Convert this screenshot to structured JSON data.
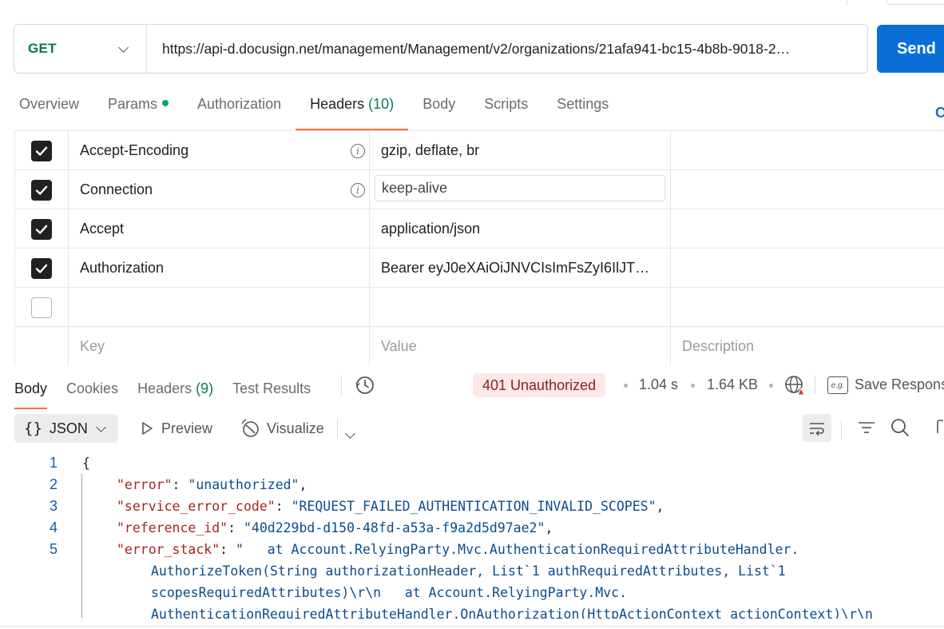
{
  "request": {
    "method": "GET",
    "url": "https://api-d.docusign.net/management/Management/v2/organizations/21afa941-bc15-4b8b-9018-2…",
    "send_label": "Send"
  },
  "request_tabs": [
    {
      "label": "Overview"
    },
    {
      "label": "Params",
      "dot": true
    },
    {
      "label": "Authorization"
    },
    {
      "label": "Headers",
      "count": "(10)",
      "active": true
    },
    {
      "label": "Body"
    },
    {
      "label": "Scripts"
    },
    {
      "label": "Settings"
    }
  ],
  "cookies_fragment": "C",
  "headers_table": {
    "rows": [
      {
        "checked": true,
        "key": "Accept-Encoding",
        "value": "gzip, deflate, br",
        "info": true
      },
      {
        "checked": true,
        "key": "Connection",
        "value": "keep-alive",
        "info": true,
        "editing": true
      },
      {
        "checked": true,
        "key": "Accept",
        "value": "application/json"
      },
      {
        "checked": true,
        "key": "Authorization",
        "value": "Bearer eyJ0eXAiOiJNVCIsImFsZyI6IlJT…"
      },
      {
        "checked": false,
        "key": "",
        "value": ""
      }
    ],
    "placeholders": {
      "key": "Key",
      "value": "Value",
      "description": "Description"
    }
  },
  "response": {
    "tabs": [
      {
        "label": "Body",
        "active": true
      },
      {
        "label": "Cookies"
      },
      {
        "label": "Headers",
        "count": "(9)"
      },
      {
        "label": "Test Results"
      }
    ],
    "status": "401 Unauthorized",
    "time": "1.04 s",
    "size": "1.64 KB",
    "save_label": "Save Respons",
    "save_icon_text": "e.g.",
    "format": "JSON",
    "format_braces": "{}",
    "preview_label": "Preview",
    "visualize_label": "Visualize"
  },
  "code_lines": [
    {
      "num": "1",
      "text": "{"
    },
    {
      "num": "2",
      "key": "\"error\"",
      "value": "\"unauthorized\"",
      "suffix": ","
    },
    {
      "num": "3",
      "key": "\"service_error_code\"",
      "value": "\"REQUEST_FAILED_AUTHENTICATION_INVALID_SCOPES\"",
      "suffix": ","
    },
    {
      "num": "4",
      "key": "\"reference_id\"",
      "value": "\"40d229bd-d150-48fd-a53a-f9a2d5d97ae2\"",
      "suffix": ","
    },
    {
      "num": "5",
      "key": "\"error_stack\"",
      "value": "\"   at Account.RelyingParty.Mvc.AuthenticationRequiredAttributeHandler."
    }
  ],
  "code_continuation": [
    "AuthorizeToken(String authorizationHeader, List`1 authRequiredAttributes, List`1",
    "scopesRequiredAttributes)\\r\\n   at Account.RelyingParty.Mvc.",
    "AuthenticationRequiredAttributeHandler.OnAuthorization(HttpActionContext actionContext)\\r\\n"
  ],
  "colors": {
    "method": "#0b7a4b",
    "send": "#0b6fd8",
    "active_tab_underline": "#ff6c37",
    "status_bg": "#fde7e7",
    "status_text": "#8a1f1f",
    "json_key": "#a1261f",
    "json_string": "#0b4c8c"
  }
}
